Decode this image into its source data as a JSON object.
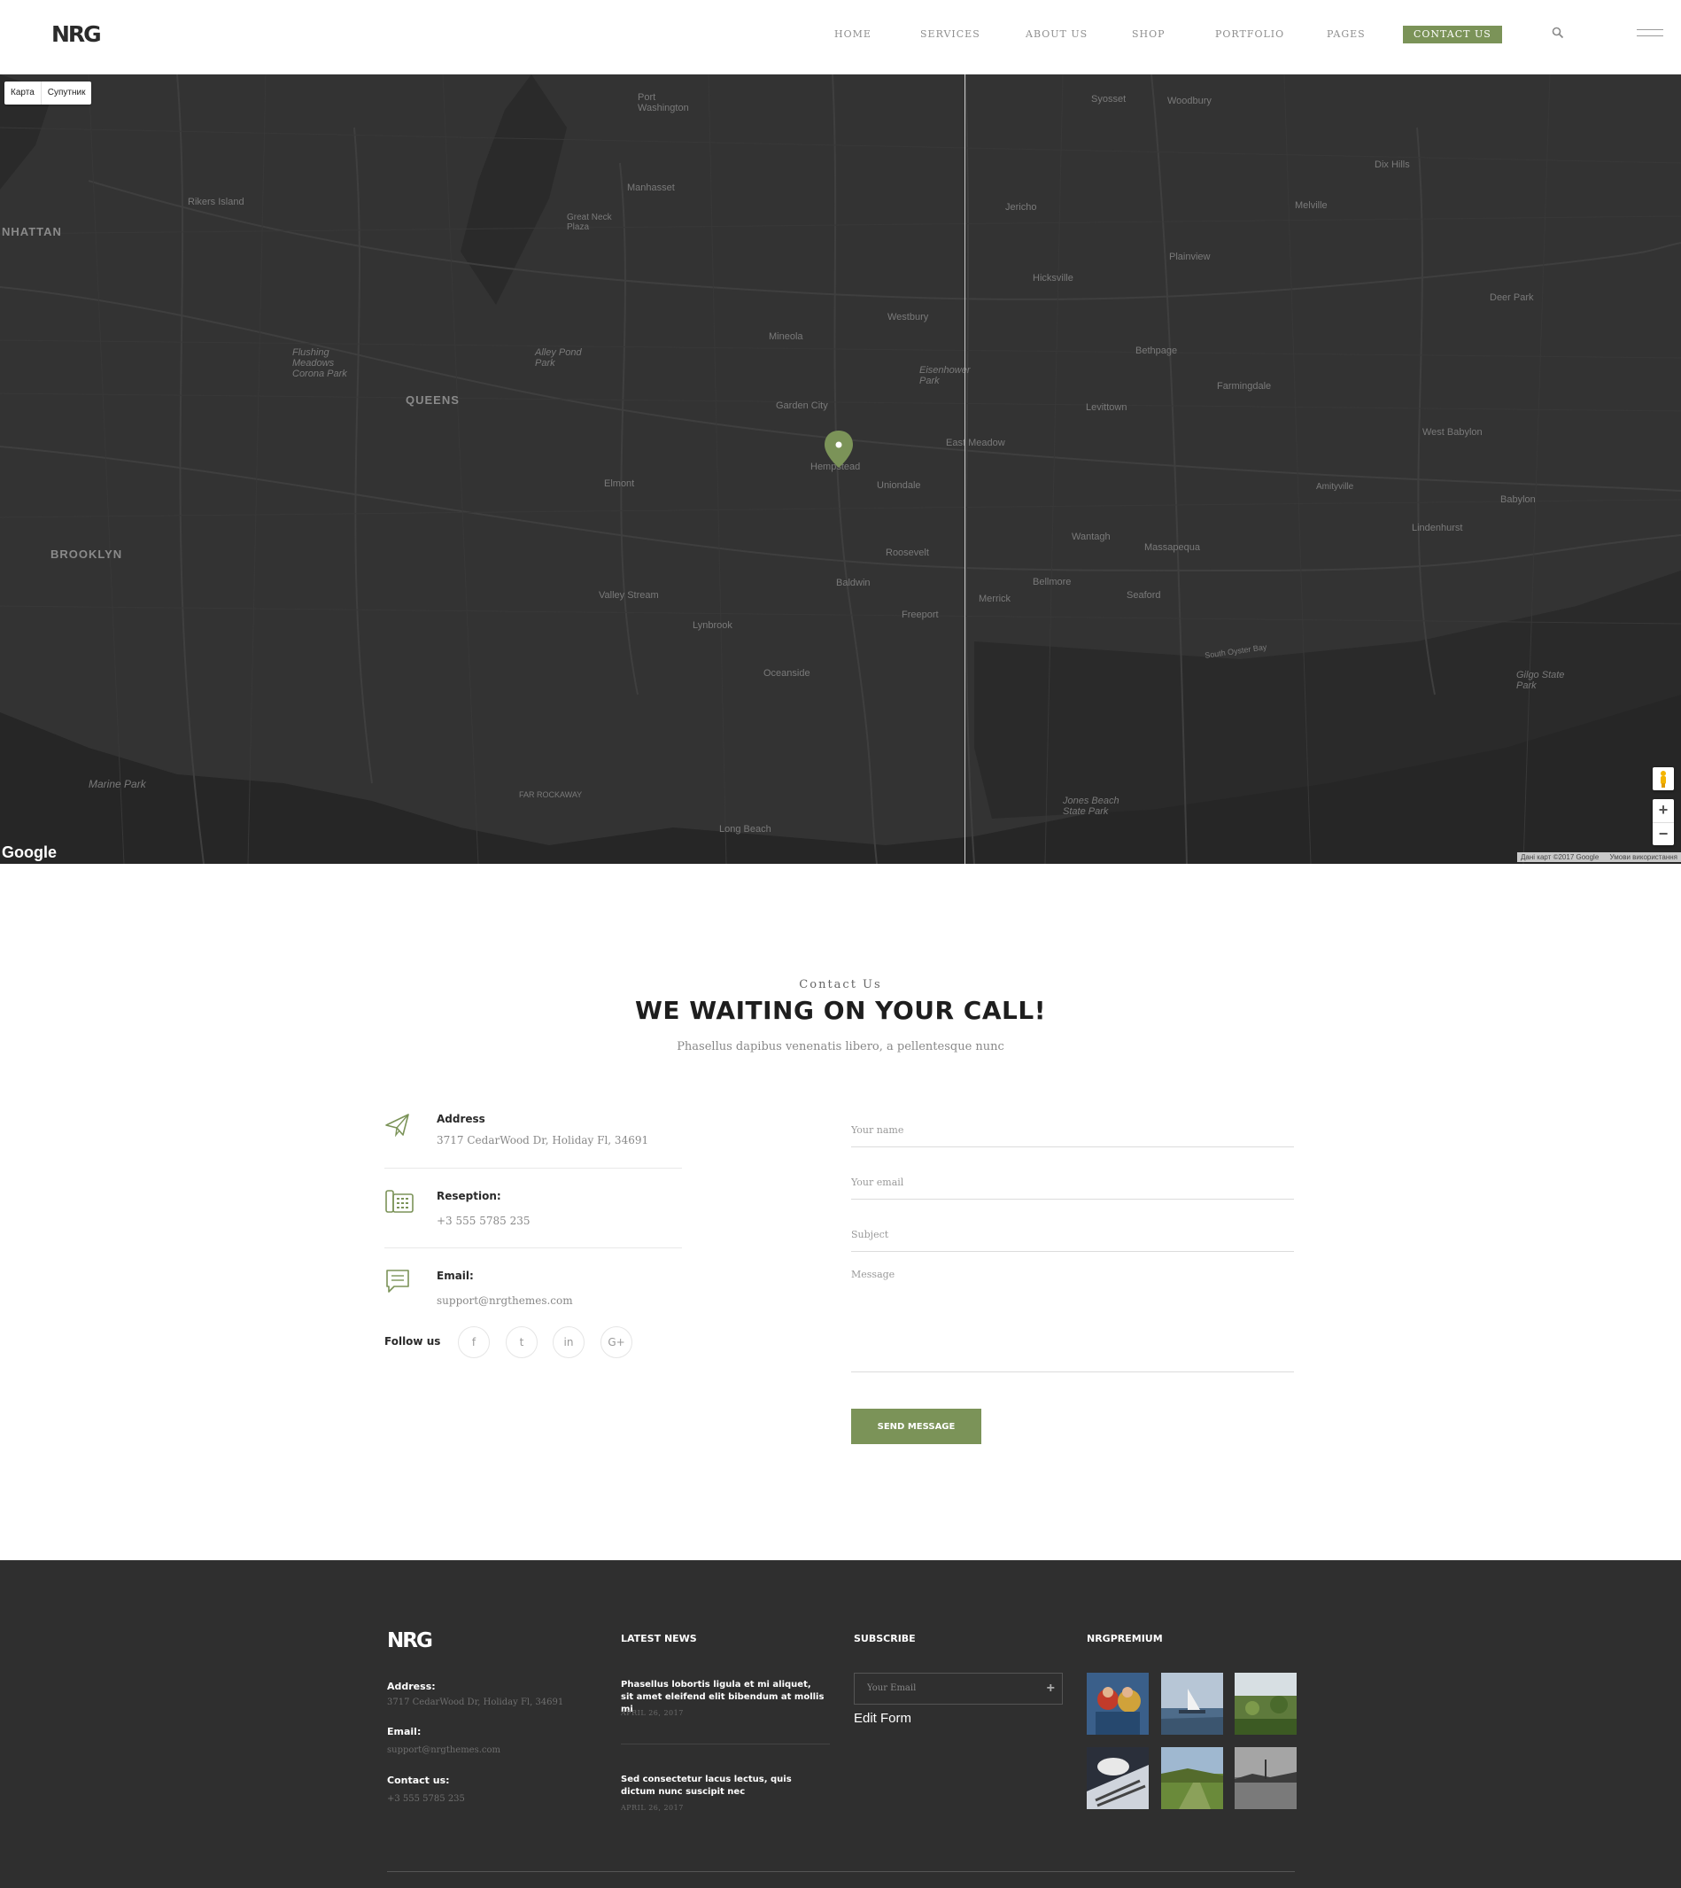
{
  "header": {
    "logo": "NRG",
    "nav": [
      "HOME",
      "SERVICES",
      "ABOUT US",
      "SHOP",
      "PORTFOLIO",
      "PAGES",
      "CONTACT US"
    ],
    "active_nav": "CONTACT US"
  },
  "map": {
    "type_buttons": [
      "Карта",
      "Супутник"
    ],
    "labels": {
      "brooklyn": "BROOKLYN",
      "queens": "QUEENS",
      "manhattan": "NHATTAN",
      "rikers": "Rikers Island",
      "flushing": "Flushing Meadows Corona Park",
      "alley": "Alley Pond Park",
      "hempstead": "Hempstead",
      "uniondale": "Uniondale",
      "elmont": "Elmont",
      "valley": "Valley Stream",
      "freeport": "Freeport",
      "baldwin": "Baldwin",
      "roosevelt": "Roosevelt",
      "levittown": "Levittown",
      "hicksville": "Hicksville",
      "bethpage": "Bethpage",
      "plainview": "Plainview",
      "jericho": "Jericho",
      "westbury": "Westbury",
      "mineola": "Mineola",
      "garden_city": "Garden City",
      "eisenhower": "Eisenhower Park",
      "east_meadow": "East Meadow",
      "merrick": "Merrick",
      "bellmore": "Bellmore",
      "wantagh": "Wantagh",
      "massapequa": "Massapequa",
      "seaford": "Seaford",
      "farmingdale": "Farmingdale",
      "west_babylon": "West Babylon",
      "babylon": "Babylon",
      "lindenhurst": "Lindenhurst",
      "amityville": "Amityville",
      "jones_beach": "Jones Beach State Park",
      "long_beach": "Long Beach",
      "oceanside": "Oceanside",
      "lynbrook": "Lynbrook",
      "marine_park": "Marine Park",
      "port_washington": "Port Washington",
      "manhasset": "Manhasset",
      "great_neck": "Great Neck Plaza",
      "melville": "Melville",
      "dix_hills": "Dix Hills",
      "deer_park": "Deer Park",
      "syosset": "Syosset",
      "woodbury": "Woodbury",
      "gilgo": "Gilgo State Park",
      "south_oyster": "South Oyster Bay",
      "far_rockaway": "FAR ROCKAWAY"
    },
    "google": "Google",
    "attribution": [
      "Дані карт ©2017 Google",
      "Умови використання"
    ],
    "zoom_in": "+",
    "zoom_out": "−"
  },
  "contact": {
    "eyebrow": "Contact Us",
    "title": "WE WAITING ON YOUR CALL!",
    "subtitle": "Phasellus dapibus venenatis libero, a pellentesque nunc",
    "address_label": "Address",
    "address_value": "3717 CedarWood Dr, Holiday Fl, 34691",
    "reception_label": "Reseption:",
    "reception_value": "+3 555 5785 235",
    "email_label": "Email:",
    "email_value": "support@nrgthemes.com",
    "follow_label": "Follow us",
    "social": [
      "f",
      "t",
      "in",
      "G+"
    ]
  },
  "form": {
    "name_placeholder": "Your name",
    "email_placeholder": "Your email",
    "subject_placeholder": "Subject",
    "message_placeholder": "Message",
    "send_label": "SEND MESSAGE"
  },
  "footer": {
    "logo": "NRG",
    "address_label": "Address:",
    "address_value": "3717 CedarWood Dr, Holiday Fl, 34691",
    "email_label": "Email:",
    "email_value": "support@nrgthemes.com",
    "contact_label": "Contact us:",
    "contact_value": "+3 555 5785 235",
    "news_heading": "LATEST NEWS",
    "news": [
      {
        "title": "Phasellus lobortis ligula et mi aliquet, sit amet eleifend elit bibendum at mollis mi",
        "date": "APRIL 26, 2017"
      },
      {
        "title": "Sed consectetur lacus lectus, quis dictum nunc suscipit nec",
        "date": "APRIL 26, 2017"
      }
    ],
    "subscribe_heading": "SUBSCRIBE",
    "subscribe_placeholder": "Your Email",
    "edit_form": "Edit Form",
    "premium_heading": "NRGPREMIUM"
  },
  "colors": {
    "accent": "#7b9358",
    "footer_bg": "#2f2f2f",
    "map_bg": "#2f2f2f"
  }
}
